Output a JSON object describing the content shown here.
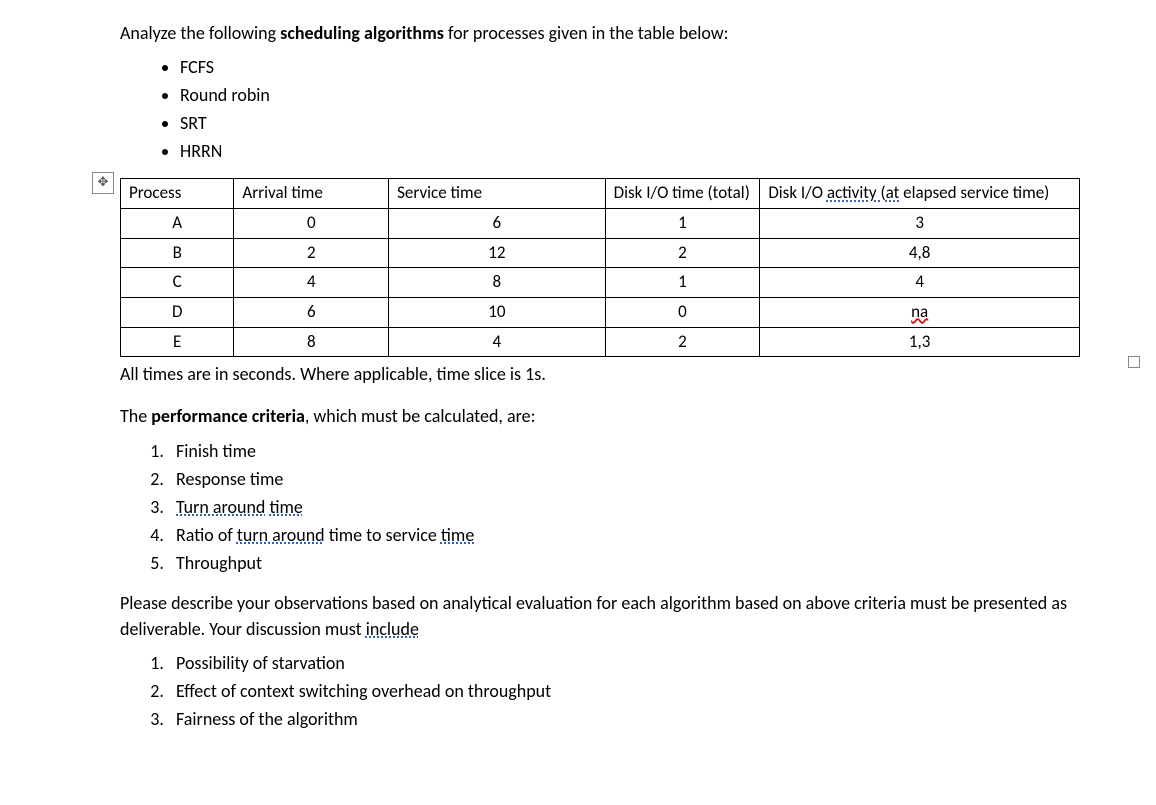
{
  "intro": {
    "prefix": "Analyze the following ",
    "bold": "scheduling algorithms",
    "suffix": " for processes given in the table below:"
  },
  "algorithms": [
    "FCFS",
    "Round robin",
    "SRT",
    "HRRN"
  ],
  "table": {
    "headers": {
      "process": "Process",
      "arrival": "Arrival time",
      "service": "Service time",
      "disk_io_total": "Disk I/O time (total)",
      "disk_io_activity_pre": "Disk I/O ",
      "disk_io_activity_u1": "activity ",
      "disk_io_activity_open": "(",
      "disk_io_activity_u2": "at",
      "disk_io_activity_post": " elapsed service time)"
    },
    "rows": [
      {
        "p": "A",
        "arr": "0",
        "svc": "6",
        "io": "1",
        "act": "3",
        "spell": false
      },
      {
        "p": "B",
        "arr": "2",
        "svc": "12",
        "io": "2",
        "act": "4,8",
        "spell": false
      },
      {
        "p": "C",
        "arr": "4",
        "svc": "8",
        "io": "1",
        "act": "4",
        "spell": false
      },
      {
        "p": "D",
        "arr": "6",
        "svc": "10",
        "io": "0",
        "act": "na",
        "spell": true
      },
      {
        "p": "E",
        "arr": "8",
        "svc": "4",
        "io": "2",
        "act": "1,3",
        "spell": false
      }
    ]
  },
  "note": "All times are in seconds. Where applicable, time slice is 1s.",
  "perf": {
    "prefix": "The ",
    "bold": "performance criteria",
    "suffix": ", which must be calculated, are:"
  },
  "criteria": {
    "item1": "Finish time",
    "item2": "Response time",
    "item3_u1": "Turn around",
    "item3_sp": " ",
    "item3_u2": "time",
    "item4_pre": "Ratio of ",
    "item4_u1": "turn around",
    "item4_mid": " time to service ",
    "item4_u2": "time",
    "item5": "Throughput"
  },
  "observations": {
    "line1": "Please describe your observations based on analytical evaluation for each algorithm based on above criteria must be presented as deliverable. Your discussion must ",
    "line1_u": "include"
  },
  "discussion": [
    "Possibility of starvation",
    "Effect of context switching overhead on throughput",
    "Fairness of the algorithm"
  ]
}
